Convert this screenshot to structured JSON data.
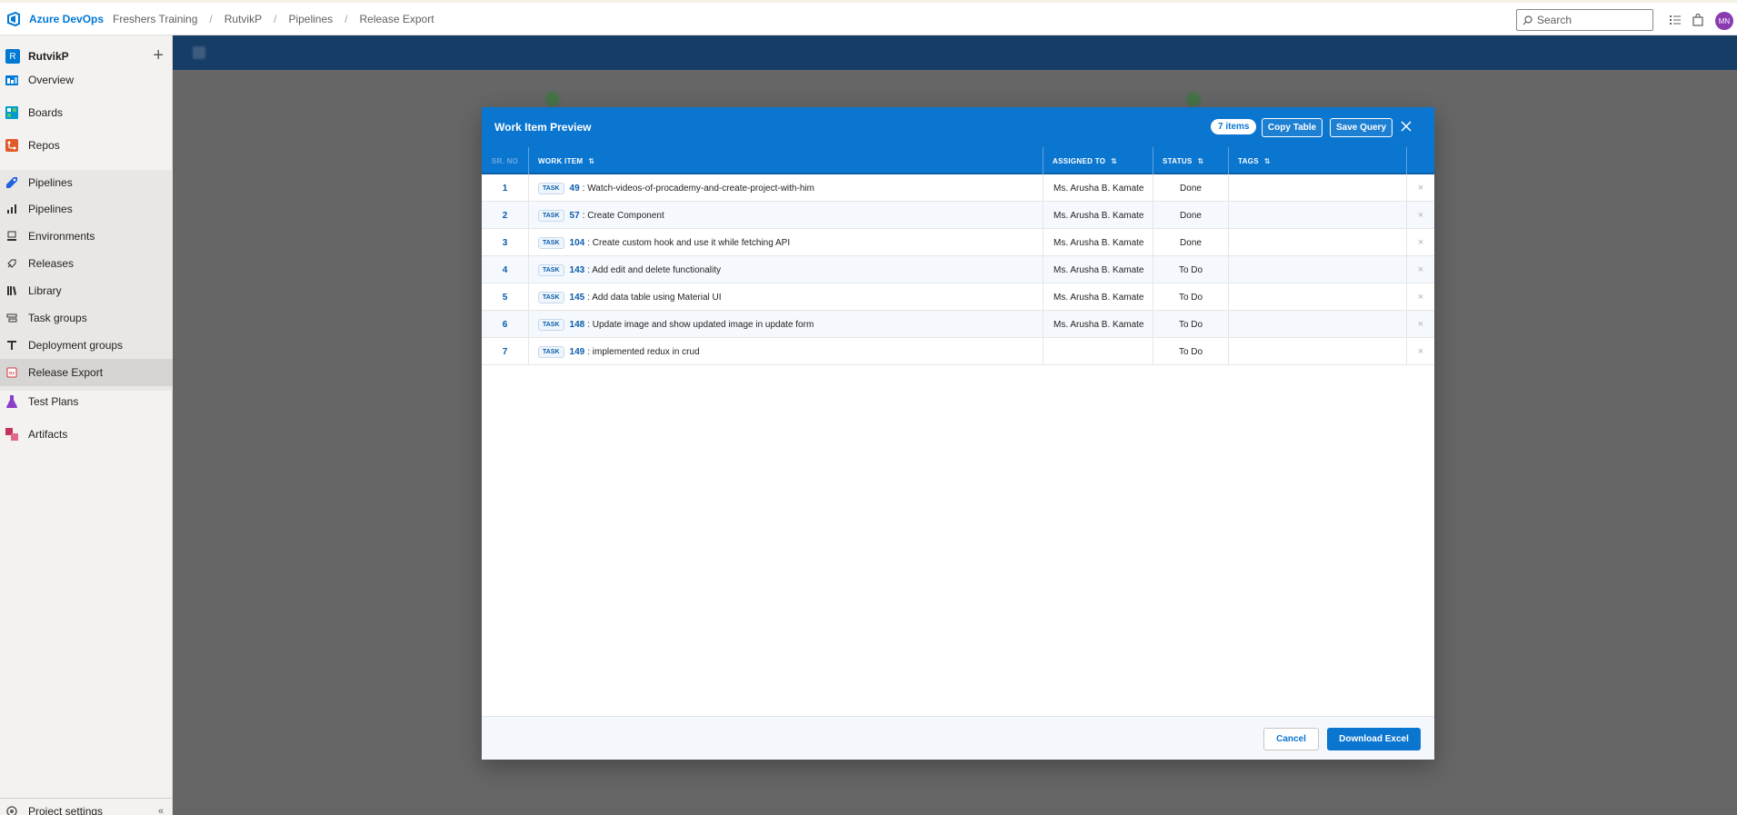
{
  "header": {
    "brand": "Azure DevOps",
    "breadcrumbs": [
      "Freshers Training",
      "RutvikP",
      "Pipelines",
      "Release Export"
    ],
    "search_placeholder": "Search",
    "avatar_initials": "MN"
  },
  "sidebar": {
    "project_initial": "R",
    "project_name": "RutvikP",
    "items": [
      {
        "label": "Overview",
        "icon": "overview-icon"
      },
      {
        "label": "Boards",
        "icon": "boards-icon"
      },
      {
        "label": "Repos",
        "icon": "repos-icon"
      },
      {
        "label": "Pipelines",
        "icon": "pipelines-icon"
      },
      {
        "label": "Pipelines",
        "icon": "pipelines-sub-icon"
      },
      {
        "label": "Environments",
        "icon": "environments-icon"
      },
      {
        "label": "Releases",
        "icon": "releases-icon"
      },
      {
        "label": "Library",
        "icon": "library-icon"
      },
      {
        "label": "Task groups",
        "icon": "task-groups-icon"
      },
      {
        "label": "Deployment groups",
        "icon": "deployment-groups-icon"
      },
      {
        "label": "Release Export",
        "icon": "release-export-icon"
      },
      {
        "label": "Test Plans",
        "icon": "test-plans-icon"
      },
      {
        "label": "Artifacts",
        "icon": "artifacts-icon"
      }
    ],
    "settings_label": "Project settings"
  },
  "modal": {
    "title": "Work Item Preview",
    "count_label": "7 items",
    "copy_label": "Copy Table",
    "save_label": "Save Query",
    "columns": [
      "SR. NO",
      "WORK ITEM",
      "ASSIGNED TO",
      "STATUS",
      "TAGS"
    ],
    "rows": [
      {
        "sr": "1",
        "type": "TASK",
        "id": "49",
        "title": ": Watch-videos-of-procademy-and-create-project-with-him",
        "assigned": "Ms. Arusha B. Kamate",
        "status": "Done",
        "tags": ""
      },
      {
        "sr": "2",
        "type": "TASK",
        "id": "57",
        "title": ": Create Component",
        "assigned": "Ms. Arusha B. Kamate",
        "status": "Done",
        "tags": ""
      },
      {
        "sr": "3",
        "type": "TASK",
        "id": "104",
        "title": ": Create custom hook and use it while fetching API",
        "assigned": "Ms. Arusha B. Kamate",
        "status": "Done",
        "tags": ""
      },
      {
        "sr": "4",
        "type": "TASK",
        "id": "143",
        "title": ": Add edit and delete functionality",
        "assigned": "Ms. Arusha B. Kamate",
        "status": "To Do",
        "tags": ""
      },
      {
        "sr": "5",
        "type": "TASK",
        "id": "145",
        "title": ": Add data table using Material UI",
        "assigned": "Ms. Arusha B. Kamate",
        "status": "To Do",
        "tags": ""
      },
      {
        "sr": "6",
        "type": "TASK",
        "id": "148",
        "title": ": Update image and show updated image in update form",
        "assigned": "Ms. Arusha B. Kamate",
        "status": "To Do",
        "tags": ""
      },
      {
        "sr": "7",
        "type": "TASK",
        "id": "149",
        "title": ": implemented redux in crud",
        "assigned": "",
        "status": "To Do",
        "tags": ""
      }
    ],
    "cancel_label": "Cancel",
    "download_label": "Download Excel"
  },
  "colors": {
    "accent": "#0b76d0",
    "overlay": "#666666",
    "sidebar_bg": "#f3f2f1"
  }
}
